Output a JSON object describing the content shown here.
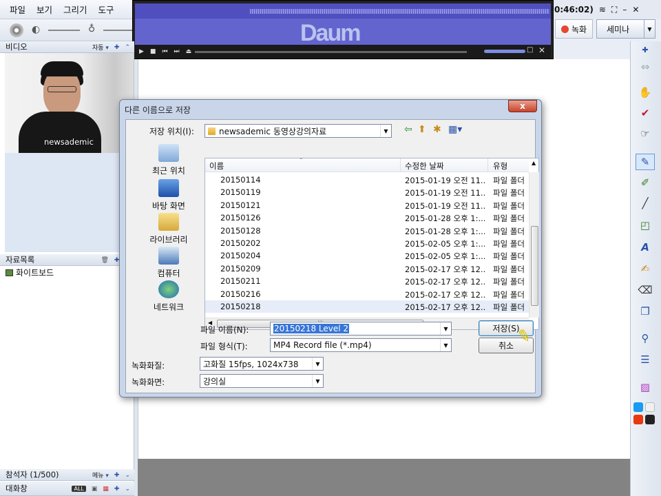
{
  "menu": [
    "파일",
    "보기",
    "그리기",
    "도구"
  ],
  "player": {
    "logo": "Daum",
    "time": "0:46:02)"
  },
  "header": {
    "record_label": "녹화",
    "seminar_label": "세미나"
  },
  "left_panel": {
    "video_title": "비디오",
    "video_mode": "자동",
    "presenter_name": "newsademic",
    "files_title": "자료목록",
    "file_item": "화이트보드",
    "participants": "참석자 (1/500)",
    "participants_menu": "메뉴",
    "chat_title": "대화창",
    "chat_all": "ALL"
  },
  "dialog": {
    "title": "다른 이름으로 저장",
    "close_label": "x",
    "save_in_label": "저장 위치(I):",
    "save_in_value": "newsademic 동영상강의자료",
    "places": [
      "최근 위치",
      "바탕 화면",
      "라이브러리",
      "컴퓨터",
      "네트워크"
    ],
    "columns": {
      "name": "이름",
      "date": "수정한 날짜",
      "type": "유형"
    },
    "files": [
      {
        "name": "20150114",
        "date": "2015-01-19 오전 11...",
        "type": "파일 폴더"
      },
      {
        "name": "20150119",
        "date": "2015-01-19 오전 11...",
        "type": "파일 폴더"
      },
      {
        "name": "20150121",
        "date": "2015-01-19 오전 11...",
        "type": "파일 폴더"
      },
      {
        "name": "20150126",
        "date": "2015-01-28 오후 1:...",
        "type": "파일 폴더"
      },
      {
        "name": "20150128",
        "date": "2015-01-28 오후 1:...",
        "type": "파일 폴더"
      },
      {
        "name": "20150202",
        "date": "2015-02-05 오후 1:...",
        "type": "파일 폴더"
      },
      {
        "name": "20150204",
        "date": "2015-02-05 오후 1:...",
        "type": "파일 폴더"
      },
      {
        "name": "20150209",
        "date": "2015-02-17 오후 12...",
        "type": "파일 폴더"
      },
      {
        "name": "20150211",
        "date": "2015-02-17 오후 12...",
        "type": "파일 폴더"
      },
      {
        "name": "20150216",
        "date": "2015-02-17 오후 12...",
        "type": "파일 폴더"
      },
      {
        "name": "20150218",
        "date": "2015-02-17 오후 12...",
        "type": "파일 폴더"
      }
    ],
    "filename_label": "파일 이름(N):",
    "filename_value": "20150218 Level 2",
    "filetype_label": "파일 형식(T):",
    "filetype_value": "MP4 Record file (*.mp4)",
    "quality_label": "녹화화질:",
    "quality_value": "고화질 15fps, 1024x738",
    "screen_label": "녹화화면:",
    "screen_value": "강의실",
    "save_button": "저장(S)",
    "cancel_button": "취소"
  },
  "colors": {
    "player_blue": "#6464cf",
    "record_red": "#e54730",
    "swatch_blue": "#1a9bf0",
    "swatch_red": "#e83a0e"
  }
}
